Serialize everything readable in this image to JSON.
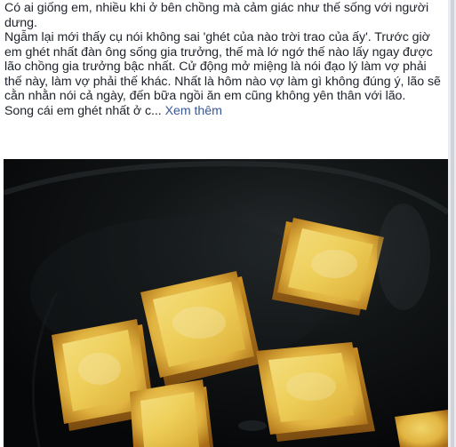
{
  "post": {
    "lines": [
      "Có ai giống em, nhiều khi ở bên chồng mà cảm giác như thế sống với người dưng.",
      "Ngẫm lại mới thấy cụ nói không sai 'ghét của nào trời trao của ấy'. Trước giờ em ghét nhất đàn ông sống gia trưởng, thế mà lớ ngớ thế nào lấy ngay được lão chồng gia trưởng bậc nhất. Cử động mở miệng là nói đạo lý làm vợ phải thế này, làm vợ phải thế khác. Nhất là hôm nào vợ làm gì không đúng ý, lão sẽ cằn nhằn nói cả ngày, đến bữa ngồi ăn em cũng không yên thân với lão."
    ],
    "truncated_line": "Song cái em ghét nhất ở c...",
    "see_more_label": "Xem thêm"
  },
  "image": {
    "subject": "fried tofu in cast iron pan",
    "colors": {
      "pan": "#0a0d0e",
      "tofu_face": "#f2d667",
      "tofu_crust": "#b87a1a",
      "tofu_edge": "#7a4a10",
      "highlight": "#f6e9b8"
    }
  }
}
